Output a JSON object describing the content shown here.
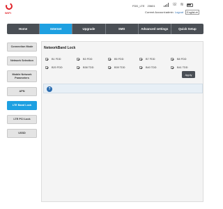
{
  "header": {
    "logo_text": "WiFi",
    "network_name": "FDD_LTE",
    "network_code": "20601",
    "account_label": "Current Account:admin",
    "logout_label": "Logout",
    "language": "English"
  },
  "topnav": {
    "tabs": [
      {
        "label": "Home",
        "active": false
      },
      {
        "label": "Internet",
        "active": true
      },
      {
        "label": "Upgrade",
        "active": false
      },
      {
        "label": "SMS",
        "active": false
      },
      {
        "label": "Advanced settings",
        "active": false
      },
      {
        "label": "Quick Setup",
        "active": false
      }
    ]
  },
  "sidebar": {
    "items": [
      {
        "label": "Connection Mode",
        "active": false
      },
      {
        "label": "Network Selection",
        "active": false
      },
      {
        "label": "Mobile Network Parameters",
        "active": false
      },
      {
        "label": "APN",
        "active": false
      },
      {
        "label": "LTE Band Lock",
        "active": true
      },
      {
        "label": "LTE PCI Lock",
        "active": false
      },
      {
        "label": "USSD",
        "active": false
      }
    ]
  },
  "main": {
    "title": "NetworkBand Lock",
    "bands": [
      {
        "label": "B1 FDD",
        "checked": true
      },
      {
        "label": "B3 FDD",
        "checked": true
      },
      {
        "label": "B5 FDD",
        "checked": true
      },
      {
        "label": "B7 FDD",
        "checked": true
      },
      {
        "label": "B8 FDD",
        "checked": true
      },
      {
        "label": "B20 FDD",
        "checked": true
      },
      {
        "label": "B38 TDD",
        "checked": true
      },
      {
        "label": "B39 TDD",
        "checked": true
      },
      {
        "label": "B40 TDD",
        "checked": true
      },
      {
        "label": "B41 TDD",
        "checked": true
      }
    ],
    "apply_label": "Apply",
    "help_glyph": "?"
  },
  "colors": {
    "accent": "#1ea0e1",
    "nav_bg": "#4a4f55",
    "brand_red": "#e02027"
  }
}
